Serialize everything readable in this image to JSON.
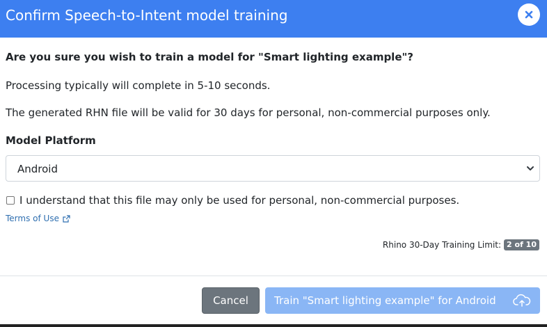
{
  "header": {
    "title": "Confirm Speech-to-Intent model training",
    "close_icon": "close-icon",
    "background_color": "#3d7ff0"
  },
  "body": {
    "question": "Are you sure you wish to train a model for \"Smart lighting example\"?",
    "processing_note": "Processing typically will complete in 5-10 seconds.",
    "validity_note": "The generated RHN file will be valid for 30 days for personal, non-commercial purposes only.",
    "platform_label": "Model Platform",
    "platform_selected": "Android",
    "checkbox_label": "I understand that this file may only be used for personal, non-commercial purposes.",
    "checkbox_checked": false,
    "terms_link": "Terms of Use",
    "terms_icon": "external-link-icon",
    "limit_label": "Rhino 30-Day Training Limit:",
    "limit_badge": "2 of 10"
  },
  "footer": {
    "cancel_label": "Cancel",
    "train_label": "Train \"Smart lighting example\" for Android",
    "train_icon": "cloud-upload-icon",
    "train_color": "#8ab6f5",
    "cancel_color": "#6c757d"
  }
}
